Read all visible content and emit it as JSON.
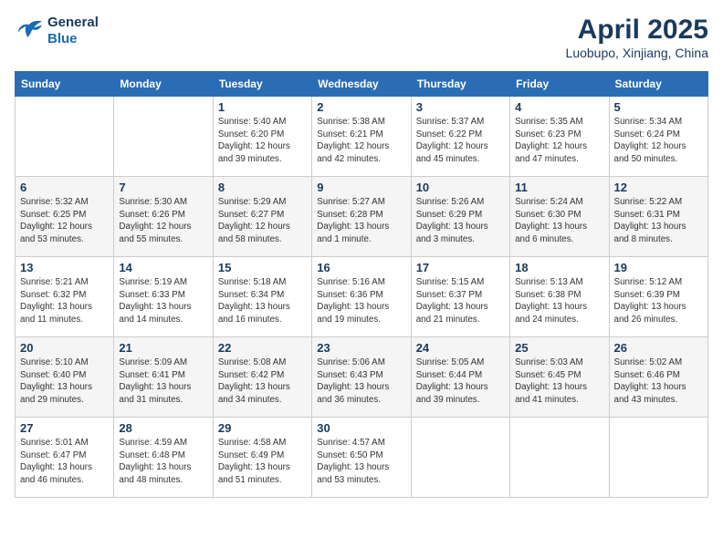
{
  "header": {
    "logo_line1": "General",
    "logo_line2": "Blue",
    "month": "April 2025",
    "location": "Luobupo, Xinjiang, China"
  },
  "weekdays": [
    "Sunday",
    "Monday",
    "Tuesday",
    "Wednesday",
    "Thursday",
    "Friday",
    "Saturday"
  ],
  "weeks": [
    [
      {
        "day": "",
        "info": ""
      },
      {
        "day": "",
        "info": ""
      },
      {
        "day": "1",
        "info": "Sunrise: 5:40 AM\nSunset: 6:20 PM\nDaylight: 12 hours and 39 minutes."
      },
      {
        "day": "2",
        "info": "Sunrise: 5:38 AM\nSunset: 6:21 PM\nDaylight: 12 hours and 42 minutes."
      },
      {
        "day": "3",
        "info": "Sunrise: 5:37 AM\nSunset: 6:22 PM\nDaylight: 12 hours and 45 minutes."
      },
      {
        "day": "4",
        "info": "Sunrise: 5:35 AM\nSunset: 6:23 PM\nDaylight: 12 hours and 47 minutes."
      },
      {
        "day": "5",
        "info": "Sunrise: 5:34 AM\nSunset: 6:24 PM\nDaylight: 12 hours and 50 minutes."
      }
    ],
    [
      {
        "day": "6",
        "info": "Sunrise: 5:32 AM\nSunset: 6:25 PM\nDaylight: 12 hours and 53 minutes."
      },
      {
        "day": "7",
        "info": "Sunrise: 5:30 AM\nSunset: 6:26 PM\nDaylight: 12 hours and 55 minutes."
      },
      {
        "day": "8",
        "info": "Sunrise: 5:29 AM\nSunset: 6:27 PM\nDaylight: 12 hours and 58 minutes."
      },
      {
        "day": "9",
        "info": "Sunrise: 5:27 AM\nSunset: 6:28 PM\nDaylight: 13 hours and 1 minute."
      },
      {
        "day": "10",
        "info": "Sunrise: 5:26 AM\nSunset: 6:29 PM\nDaylight: 13 hours and 3 minutes."
      },
      {
        "day": "11",
        "info": "Sunrise: 5:24 AM\nSunset: 6:30 PM\nDaylight: 13 hours and 6 minutes."
      },
      {
        "day": "12",
        "info": "Sunrise: 5:22 AM\nSunset: 6:31 PM\nDaylight: 13 hours and 8 minutes."
      }
    ],
    [
      {
        "day": "13",
        "info": "Sunrise: 5:21 AM\nSunset: 6:32 PM\nDaylight: 13 hours and 11 minutes."
      },
      {
        "day": "14",
        "info": "Sunrise: 5:19 AM\nSunset: 6:33 PM\nDaylight: 13 hours and 14 minutes."
      },
      {
        "day": "15",
        "info": "Sunrise: 5:18 AM\nSunset: 6:34 PM\nDaylight: 13 hours and 16 minutes."
      },
      {
        "day": "16",
        "info": "Sunrise: 5:16 AM\nSunset: 6:36 PM\nDaylight: 13 hours and 19 minutes."
      },
      {
        "day": "17",
        "info": "Sunrise: 5:15 AM\nSunset: 6:37 PM\nDaylight: 13 hours and 21 minutes."
      },
      {
        "day": "18",
        "info": "Sunrise: 5:13 AM\nSunset: 6:38 PM\nDaylight: 13 hours and 24 minutes."
      },
      {
        "day": "19",
        "info": "Sunrise: 5:12 AM\nSunset: 6:39 PM\nDaylight: 13 hours and 26 minutes."
      }
    ],
    [
      {
        "day": "20",
        "info": "Sunrise: 5:10 AM\nSunset: 6:40 PM\nDaylight: 13 hours and 29 minutes."
      },
      {
        "day": "21",
        "info": "Sunrise: 5:09 AM\nSunset: 6:41 PM\nDaylight: 13 hours and 31 minutes."
      },
      {
        "day": "22",
        "info": "Sunrise: 5:08 AM\nSunset: 6:42 PM\nDaylight: 13 hours and 34 minutes."
      },
      {
        "day": "23",
        "info": "Sunrise: 5:06 AM\nSunset: 6:43 PM\nDaylight: 13 hours and 36 minutes."
      },
      {
        "day": "24",
        "info": "Sunrise: 5:05 AM\nSunset: 6:44 PM\nDaylight: 13 hours and 39 minutes."
      },
      {
        "day": "25",
        "info": "Sunrise: 5:03 AM\nSunset: 6:45 PM\nDaylight: 13 hours and 41 minutes."
      },
      {
        "day": "26",
        "info": "Sunrise: 5:02 AM\nSunset: 6:46 PM\nDaylight: 13 hours and 43 minutes."
      }
    ],
    [
      {
        "day": "27",
        "info": "Sunrise: 5:01 AM\nSunset: 6:47 PM\nDaylight: 13 hours and 46 minutes."
      },
      {
        "day": "28",
        "info": "Sunrise: 4:59 AM\nSunset: 6:48 PM\nDaylight: 13 hours and 48 minutes."
      },
      {
        "day": "29",
        "info": "Sunrise: 4:58 AM\nSunset: 6:49 PM\nDaylight: 13 hours and 51 minutes."
      },
      {
        "day": "30",
        "info": "Sunrise: 4:57 AM\nSunset: 6:50 PM\nDaylight: 13 hours and 53 minutes."
      },
      {
        "day": "",
        "info": ""
      },
      {
        "day": "",
        "info": ""
      },
      {
        "day": "",
        "info": ""
      }
    ]
  ]
}
